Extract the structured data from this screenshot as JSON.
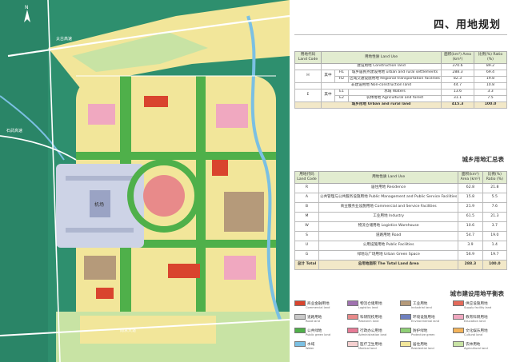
{
  "page_title": "四、用地规划",
  "summary_table": {
    "caption": "城乡用地汇总表",
    "headers": {
      "code": "用地代码 Land Code",
      "use": "用地性质 Land Use",
      "area": "面积(km²) Area (km²)",
      "ratio": "比例(%) Ratio (%)"
    },
    "rows": [
      {
        "code": "",
        "sub": "",
        "name": "建设用地 Construction land",
        "area": "370.6",
        "ratio": "89.2"
      },
      {
        "code": "H",
        "sub": "其中",
        "subcode": "H1",
        "name": "城乡居民点建设用地 urban and rural settlements",
        "area": "288.3",
        "ratio": "69.4"
      },
      {
        "code": "",
        "sub": "",
        "subcode": "H2",
        "name": "区域交通设施用地 Regional transportation facilities",
        "area": "82.3",
        "ratio": "19.8"
      },
      {
        "code": "",
        "sub": "",
        "name": "非建设用地 Non-construction land",
        "area": "44.7",
        "ratio": "10.8"
      },
      {
        "code": "E",
        "sub": "其中",
        "subcode": "E1",
        "name": "水域 Waters",
        "area": "13.6",
        "ratio": "3.3"
      },
      {
        "code": "",
        "sub": "",
        "subcode": "E2",
        "name": "农林用地 Agricultural and forest",
        "area": "31.1",
        "ratio": "7.5"
      },
      {
        "code": "",
        "sub": "",
        "name": "城乡用地 Urban and rural land",
        "area": "415.3",
        "ratio": "100.0",
        "total": true
      }
    ]
  },
  "balance_table": {
    "caption": "城市建设用地平衡表",
    "headers": {
      "code": "用地代码 Land Code",
      "use": "用地性质 Land Use",
      "area": "面积(km²) Area (km²)",
      "ratio": "比例(%) Ratio (%)"
    },
    "rows": [
      {
        "code": "R",
        "name": "居住用地 Residence",
        "area": "62.8",
        "ratio": "21.8"
      },
      {
        "code": "A",
        "name": "公共管理与公共服务设施用地 Public Management and Public Service Facilities",
        "area": "15.8",
        "ratio": "5.5"
      },
      {
        "code": "B",
        "name": "商业服务业设施用地 Commercial and Service Facilities",
        "area": "21.9",
        "ratio": "7.6"
      },
      {
        "code": "M",
        "name": "工业用地 Industry",
        "area": "61.5",
        "ratio": "21.3"
      },
      {
        "code": "W",
        "name": "物流仓储用地 Logistics Warehouse",
        "area": "10.6",
        "ratio": "3.7"
      },
      {
        "code": "S",
        "name": "道路用地 Road",
        "area": "54.7",
        "ratio": "19.0"
      },
      {
        "code": "U",
        "name": "公用设施用地 Public Facilities",
        "area": "3.9",
        "ratio": "1.4"
      },
      {
        "code": "G",
        "name": "绿地与广场用地 Urban Green Space",
        "area": "56.9",
        "ratio": "19.7"
      },
      {
        "code": "总计 Total",
        "name": "总用地面积 The Total Land Area",
        "area": "288.3",
        "ratio": "100.0",
        "total": true
      }
    ]
  },
  "legend": [
    {
      "zh": "商业金融用地",
      "en": "Commercial land",
      "color": "#d9442e"
    },
    {
      "zh": "物流仓储用地",
      "en": "Logistics land",
      "color": "#a072b0"
    },
    {
      "zh": "工业用地",
      "en": "Industrial land",
      "color": "#b59a7a"
    },
    {
      "zh": "供应设施用地",
      "en": "Supply facility land",
      "color": "#e46a5a"
    },
    {
      "zh": "道路用地",
      "en": "Road land",
      "color": "#c9c9c9"
    },
    {
      "zh": "科研院校用地",
      "en": "Research land",
      "color": "#e88a8a"
    },
    {
      "zh": "环境设施用地",
      "en": "Environmental land",
      "color": "#6e7fbf"
    },
    {
      "zh": "教育科研用地",
      "en": "Education land",
      "color": "#f0a8c0"
    },
    {
      "zh": "公共绿地",
      "en": "Public green land",
      "color": "#4fb04a"
    },
    {
      "zh": "行政办公用地",
      "en": "Administration land",
      "color": "#e77b96"
    },
    {
      "zh": "防护绿地",
      "en": "Protective green",
      "color": "#8fcf76"
    },
    {
      "zh": "文化娱乐用地",
      "en": "Cultural land",
      "color": "#f3b35a"
    },
    {
      "zh": "水域",
      "en": "Water",
      "color": "#7bc0e3"
    },
    {
      "zh": "医疗卫生用地",
      "en": "Medical land",
      "color": "#f6d0d0"
    },
    {
      "zh": "居住用地",
      "en": "Residential land",
      "color": "#f2e69a"
    },
    {
      "zh": "农林用地",
      "en": "Agricultural land",
      "color": "#c8e3a4"
    }
  ],
  "map_labels": {
    "airport": "机场",
    "road_north": "太古高速",
    "road_west": "石武高速",
    "road_south": "南京大道"
  }
}
